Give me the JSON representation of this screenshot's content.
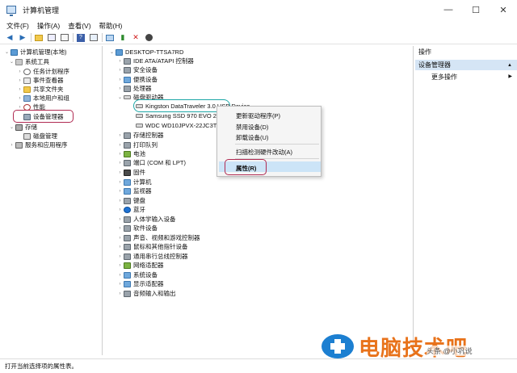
{
  "window": {
    "title": "计算机管理",
    "controls": {
      "minimize": "—",
      "maximize": "☐",
      "close": "✕"
    }
  },
  "menu": [
    "文件(F)",
    "操作(A)",
    "查看(V)",
    "帮助(H)"
  ],
  "toolbar": [
    "back-icon",
    "forward-icon",
    "up-folder-icon",
    "show-tree-icon",
    "export-icon",
    "help-icon",
    "properties-icon",
    "scan-icon",
    "update-driver-icon",
    "uninstall-icon",
    "disable-icon"
  ],
  "left_tree": {
    "root": "计算机管理(本地)",
    "system_tools": "系统工具",
    "task_scheduler": "任务计划程序",
    "event_viewer": "事件查看器",
    "shared_folders": "共享文件夹",
    "local_users": "本地用户和组",
    "performance": "性能",
    "device_manager": "设备管理器",
    "storage": "存储",
    "disk_management": "磁盘管理",
    "services_apps": "服务和应用程序"
  },
  "device_tree": {
    "computer": "DESKTOP-TTSA7RD",
    "categories": [
      "IDE ATA/ATAPI 控制器",
      "安全设备",
      "便携设备",
      "处理器",
      "磁盘驱动器",
      "存储控制器",
      "打印队列",
      "电池",
      "端口 (COM 和 LPT)",
      "固件",
      "计算机",
      "监视器",
      "键盘",
      "蓝牙",
      "人体学输入设备",
      "软件设备",
      "声音、视频和游戏控制器",
      "鼠标和其他指针设备",
      "通用串行总线控制器",
      "网络适配器",
      "系统设备",
      "显示适配器",
      "音频输入和输出"
    ],
    "disks": [
      "Kingston DataTraveler 3.0 USB Device",
      "Samsung SSD 970 EVO 2",
      "WDC WD10JPVX-22JC3T"
    ]
  },
  "context_menu": {
    "update": "更新驱动程序(P)",
    "disable": "禁用设备(D)",
    "uninstall": "卸载设备(U)",
    "scan": "扫描检测硬件改动(A)",
    "properties": "属性(R)"
  },
  "actions": {
    "header": "操作",
    "section": "设备管理器",
    "more": "更多操作"
  },
  "status": "打开当前选择项的属性表。",
  "watermark": {
    "text": "电脑技术吧",
    "small": "头条 @小巩说"
  },
  "colors": {
    "highlight_oval": "#b02b52",
    "teal_oval": "#1ea7a7",
    "menu_highlight": "#cce4f7",
    "action_header": "#d5e5f5",
    "watermark": "#e8721a"
  }
}
